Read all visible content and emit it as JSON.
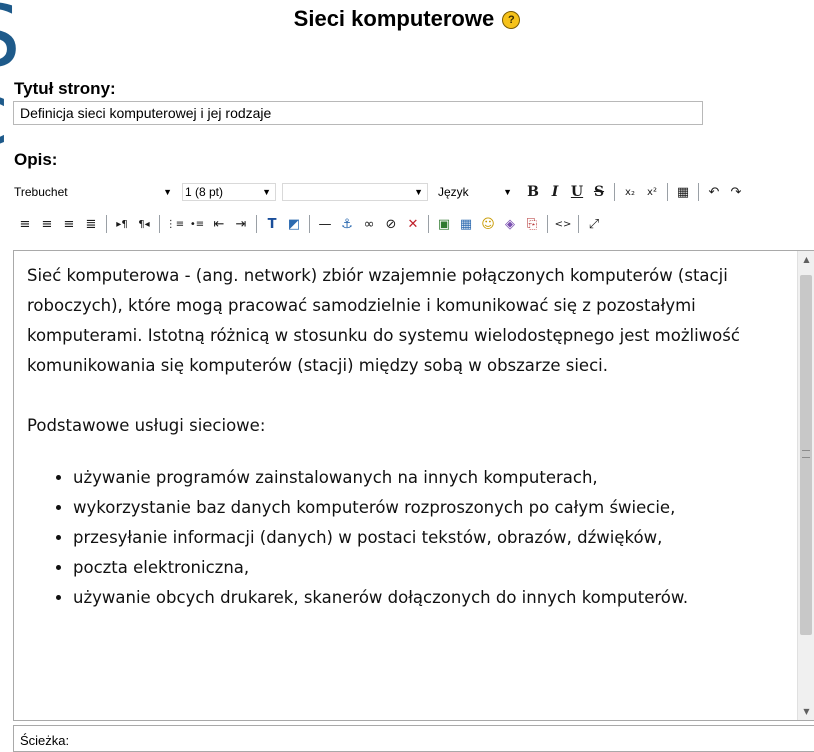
{
  "page": {
    "title": "Sieci komputerowe",
    "help_icon": "help-icon"
  },
  "background_glyphs": [
    "S",
    "c"
  ],
  "form": {
    "title_label": "Tytuł strony:",
    "title_value": "Definicja sieci komputerowej i jej rodzaje",
    "description_label": "Opis:"
  },
  "toolbar": {
    "font_family": "Trebuchet",
    "font_size": "1 (8 pt)",
    "style": "",
    "language": "Język",
    "row1_buttons": [
      {
        "icon": "bold-icon",
        "glyph": "B"
      },
      {
        "icon": "italic-icon",
        "glyph": "I"
      },
      {
        "icon": "underline-icon",
        "glyph": "U"
      },
      {
        "icon": "strikethrough-icon",
        "glyph": "S"
      },
      {
        "icon": "subscript-icon",
        "glyph": "x₂"
      },
      {
        "icon": "superscript-icon",
        "glyph": "x²"
      },
      {
        "icon": "paste-word-icon",
        "glyph": "▦"
      },
      {
        "icon": "undo-icon",
        "glyph": "↶"
      },
      {
        "icon": "redo-icon",
        "glyph": "↷"
      }
    ],
    "row2_buttons": [
      {
        "icon": "align-left-icon",
        "glyph": "≡"
      },
      {
        "icon": "align-center-icon",
        "glyph": "≡"
      },
      {
        "icon": "align-right-icon",
        "glyph": "≡"
      },
      {
        "icon": "justify-icon",
        "glyph": "≣"
      },
      {
        "icon": "ltr-icon",
        "glyph": "▸¶"
      },
      {
        "icon": "rtl-icon",
        "glyph": "¶◂"
      },
      {
        "icon": "ordered-list-icon",
        "glyph": "⋮≡"
      },
      {
        "icon": "unordered-list-icon",
        "glyph": "•≡"
      },
      {
        "icon": "outdent-icon",
        "glyph": "⇤"
      },
      {
        "icon": "indent-icon",
        "glyph": "⇥"
      },
      {
        "icon": "text-color-icon",
        "glyph": "T"
      },
      {
        "icon": "background-color-icon",
        "glyph": "◩"
      },
      {
        "icon": "horizontal-rule-icon",
        "glyph": "—"
      },
      {
        "icon": "anchor-icon",
        "glyph": "⚓"
      },
      {
        "icon": "link-icon",
        "glyph": "∞"
      },
      {
        "icon": "unlink-icon",
        "glyph": "⊘"
      },
      {
        "icon": "nolink-icon",
        "glyph": "✕"
      },
      {
        "icon": "insert-image-icon",
        "glyph": "▣"
      },
      {
        "icon": "insert-table-icon",
        "glyph": "▦"
      },
      {
        "icon": "smiley-icon",
        "glyph": "☺"
      },
      {
        "icon": "special-char-icon",
        "glyph": "◈"
      },
      {
        "icon": "search-replace-icon",
        "glyph": "⎘"
      },
      {
        "icon": "html-source-icon",
        "glyph": "<>"
      },
      {
        "icon": "fullscreen-icon",
        "glyph": "⤢"
      }
    ]
  },
  "editor": {
    "paragraph1": "Sieć komputerowa - (ang. network) zbiór wzajemnie połączonych komputerów (stacji roboczych), które mogą pracować samodzielnie i komunikować się z pozostałymi komputerami. Istotną różnicą w stosunku do systemu wielodostępnego jest możliwość komunikowania się komputerów (stacji) między sobą w obszarze sieci.",
    "paragraph2": "Podstawowe usługi sieciowe:",
    "list": [
      "używanie programów zainstalowanych na innych komputerach,",
      "wykorzystanie baz danych komputerów rozproszonych po całym świecie,",
      "przesyłanie informacji (danych) w postaci tekstów, obrazów, dźwięków,",
      "poczta elektroniczna,",
      "używanie obcych drukarek, skanerów dołączonych do innych komputerów."
    ]
  },
  "path_bar": {
    "label": "Ścieżka:"
  }
}
